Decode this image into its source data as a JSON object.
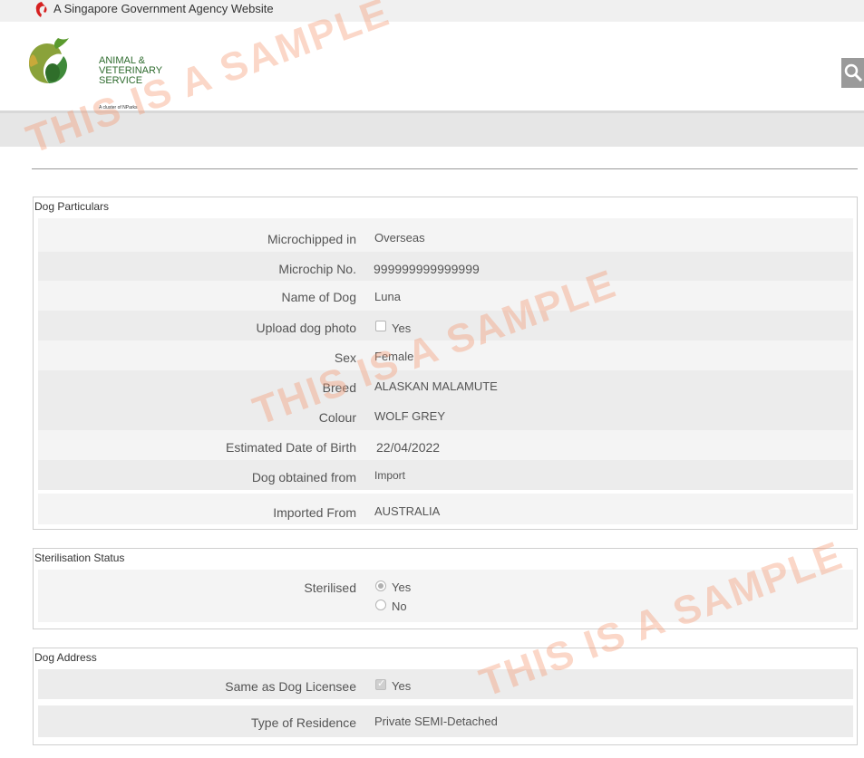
{
  "gov_bar": {
    "text": "A Singapore Government Agency Website",
    "icon": "lion-head-icon"
  },
  "header": {
    "logo_lines": [
      "ANIMAL &",
      "VETERINARY",
      "SERVICE"
    ],
    "logo_sub": "A cluster of NParks",
    "search_icon": "search-icon"
  },
  "dog_particulars": {
    "legend": "Dog Particulars",
    "rows": [
      {
        "label": "Microchipped in",
        "value": "Overseas"
      },
      {
        "label": "Microchip No.",
        "value": "999999999999999"
      },
      {
        "label": "Name of Dog",
        "value": "Luna"
      },
      {
        "label": "Upload dog photo",
        "value": "Yes",
        "checked": false
      },
      {
        "label": "Sex",
        "value": "Female"
      },
      {
        "label": "Breed",
        "value": "ALASKAN MALAMUTE"
      },
      {
        "label": "Colour",
        "value": "WOLF GREY"
      },
      {
        "label": "Estimated Date of Birth",
        "value": "22/04/2022"
      },
      {
        "label": "Dog obtained from",
        "value": "Import"
      },
      {
        "label": "Imported From",
        "value": "AUSTRALIA"
      }
    ]
  },
  "sterilisation": {
    "legend": "Sterilisation Status",
    "label": "Sterilised",
    "options": [
      "Yes",
      "No"
    ],
    "selected": "Yes"
  },
  "dog_address": {
    "legend": "Dog Address",
    "rows": [
      {
        "label": "Same as Dog Licensee",
        "value": "Yes",
        "checked": true
      },
      {
        "label": "Type of Residence",
        "value": "Private SEMI-Detached"
      }
    ]
  },
  "watermark": "THIS IS A SAMPLE",
  "colors": {
    "watermark": "#f5966e",
    "logo_green": "#2e6b2e",
    "row_shade": "#ececec"
  }
}
